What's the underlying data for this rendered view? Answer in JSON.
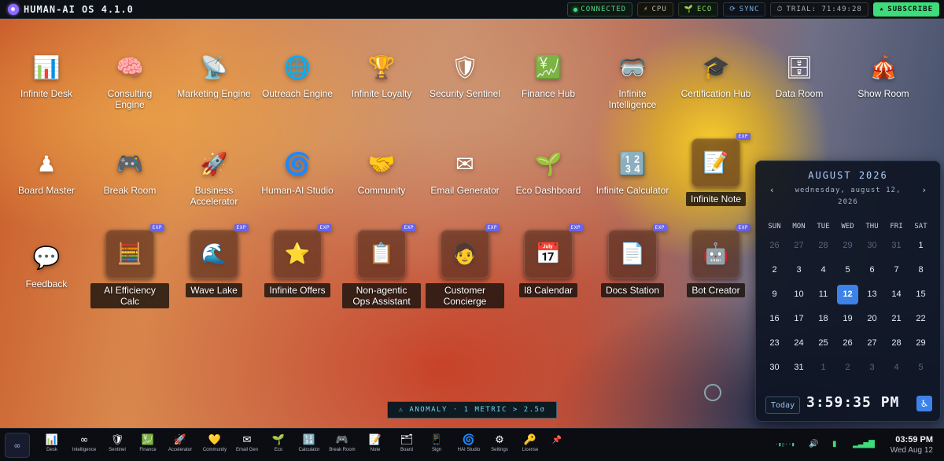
{
  "topbar": {
    "brand": "HUMAN-AI OS 4.1.0",
    "status": {
      "connected": "CONNECTED",
      "cpu": "CPU",
      "eco": "ECO",
      "sync": "SYNC"
    },
    "trial": "TRIAL: 71:49:28",
    "subscribe": "SUBSCRIBE"
  },
  "desktop": {
    "apps": [
      {
        "label": "Infinite Desk",
        "icon": "📊"
      },
      {
        "label": "Consulting Engine",
        "icon": "🧠"
      },
      {
        "label": "Marketing Engine",
        "icon": "📡"
      },
      {
        "label": "Outreach Engine",
        "icon": "🌐"
      },
      {
        "label": "Infinite Loyalty",
        "icon": "🏆"
      },
      {
        "label": "Security Sentinel",
        "icon": "🛡"
      },
      {
        "label": "Finance Hub",
        "icon": "💹"
      },
      {
        "label": "Infinite Intelligence",
        "icon": "🥽"
      },
      {
        "label": "Certification Hub",
        "icon": "🎓"
      },
      {
        "label": "Data Room",
        "icon": "🗄"
      },
      {
        "label": "Show Room",
        "icon": "🎪"
      },
      {
        "label": "Board Master",
        "icon": "♟"
      },
      {
        "label": "Break Room",
        "icon": "🎮"
      },
      {
        "label": "Business Accelerator",
        "icon": "🚀"
      },
      {
        "label": "Human-AI Studio",
        "icon": "🌀"
      },
      {
        "label": "Community",
        "icon": "🤝"
      },
      {
        "label": "Email Generator",
        "icon": "✉"
      },
      {
        "label": "Eco Dashboard",
        "icon": "🌱"
      },
      {
        "label": "Infinite Calculator",
        "icon": "🔢"
      },
      {
        "label": "Infinite Note",
        "icon": "📝"
      },
      {
        "label": "Feedback",
        "icon": "💬"
      },
      {
        "label": "AI Efficiency Calc",
        "icon": "🧮"
      },
      {
        "label": "Wave Lake",
        "icon": "🌊"
      },
      {
        "label": "Infinite Offers",
        "icon": "⭐"
      },
      {
        "label": "Non-agentic Ops Assistant",
        "icon": "📋"
      },
      {
        "label": "Customer Concierge",
        "icon": "🧑"
      },
      {
        "label": "I8 Calendar",
        "icon": "📅"
      },
      {
        "label": "Docs Station",
        "icon": "📄"
      },
      {
        "label": "Bot Creator",
        "icon": "🤖"
      }
    ],
    "exp_badge": "EXP",
    "anomaly": "⚠ ANOMALY · 1 METRIC > 2.5σ"
  },
  "calendar": {
    "month": "AUGUST 2026",
    "date_line": "wednesday, august 12, 2026",
    "prev": "‹",
    "next": "›",
    "weekdays": [
      "SUN",
      "MON",
      "TUE",
      "WED",
      "THU",
      "FRI",
      "SAT"
    ],
    "days": [
      "26",
      "27",
      "28",
      "29",
      "30",
      "31",
      "1",
      "2",
      "3",
      "4",
      "5",
      "6",
      "7",
      "8",
      "9",
      "10",
      "11",
      "12",
      "13",
      "14",
      "15",
      "16",
      "17",
      "18",
      "19",
      "20",
      "21",
      "22",
      "23",
      "24",
      "25",
      "26",
      "27",
      "28",
      "29",
      "30",
      "31",
      "1",
      "2",
      "3",
      "4",
      "5"
    ],
    "today_label": "Today",
    "clock": "3:59:35 PM",
    "accessibility_icon": "♿"
  },
  "taskbar": {
    "start": "∞",
    "items": [
      {
        "label": "Desk",
        "icon": "📊"
      },
      {
        "label": "Intelligence",
        "icon": "∞"
      },
      {
        "label": "Sentinel",
        "icon": "🛡"
      },
      {
        "label": "Finance",
        "icon": "💹"
      },
      {
        "label": "Accelerator",
        "icon": "🚀"
      },
      {
        "label": "Community",
        "icon": "💛"
      },
      {
        "label": "Email Gen",
        "icon": "✉"
      },
      {
        "label": "Eco",
        "icon": "🌱"
      },
      {
        "label": "Calculator",
        "icon": "🔢"
      },
      {
        "label": "Break Room",
        "icon": "🎮"
      },
      {
        "label": "Note",
        "icon": "📝"
      },
      {
        "label": "Board",
        "icon": "🗂"
      },
      {
        "label": "Sign",
        "icon": "📱"
      },
      {
        "label": "HAI Studio",
        "icon": "🌀"
      },
      {
        "label": "Settings",
        "icon": "⚙"
      },
      {
        "label": "License",
        "icon": "🔑"
      }
    ],
    "pin_icon": "📌",
    "tray_wave": "·▮▯··▮",
    "time": "03:59 PM",
    "date": "Wed Aug 12"
  },
  "colors": {
    "accent": "#3edc7a",
    "selected_day": "#3c82e8",
    "exp_badge": "#6a64e8",
    "anomaly_text": "#6fd6e8"
  }
}
